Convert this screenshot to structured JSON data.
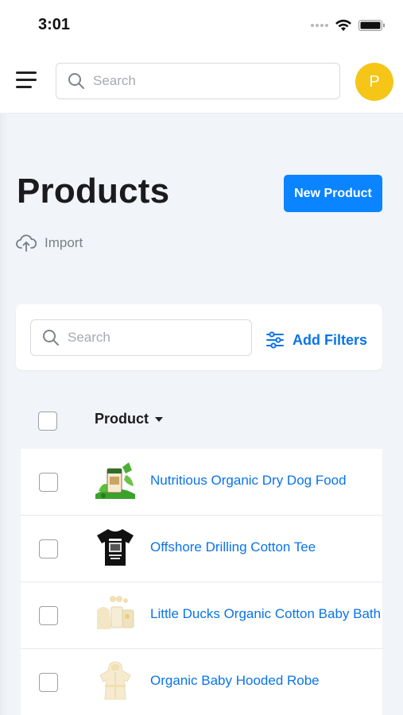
{
  "status_bar": {
    "time": "3:01"
  },
  "header": {
    "search_placeholder": "Search",
    "avatar_initial": "P"
  },
  "page": {
    "title": "Products",
    "new_product_label": "New Product",
    "import_label": "Import"
  },
  "filters": {
    "search_placeholder": "Search",
    "add_filters_label": "Add Filters"
  },
  "table": {
    "column_header": "Product",
    "rows": [
      {
        "name": "Nutritious Organic Dry Dog Food",
        "thumb": "dog-food-icon"
      },
      {
        "name": "Offshore Drilling Cotton Tee",
        "thumb": "tshirt-icon"
      },
      {
        "name": "Little Ducks Organic Cotton Baby Bath Set",
        "thumb": "baby-bath-set-icon"
      },
      {
        "name": "Organic Baby Hooded Robe",
        "thumb": "baby-robe-icon"
      }
    ]
  },
  "colors": {
    "accent": "#0a84ff",
    "link": "#0a74e8",
    "avatar": "#f5c518",
    "background": "#f1f4f8"
  }
}
